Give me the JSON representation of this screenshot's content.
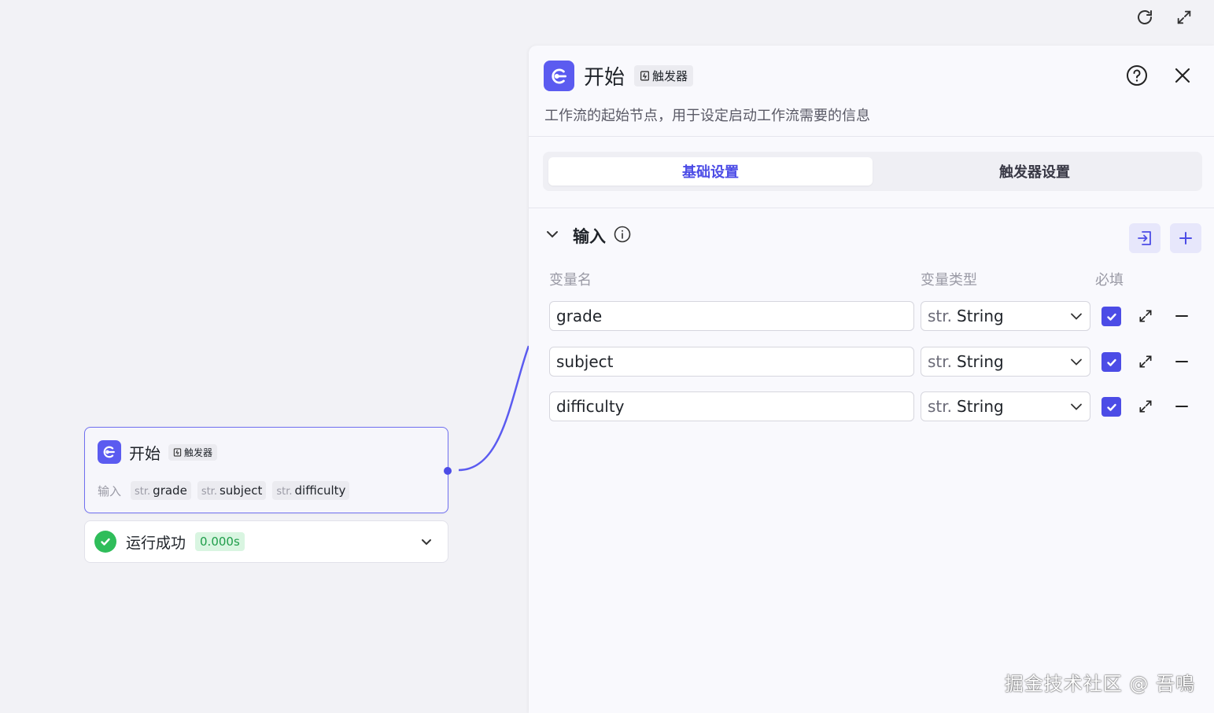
{
  "canvas_node": {
    "title": "开始",
    "trigger_tag": "触发器",
    "inputs_label": "输入",
    "inputs": [
      {
        "type_prefix": "str.",
        "name": "grade"
      },
      {
        "type_prefix": "str.",
        "name": "subject"
      },
      {
        "type_prefix": "str.",
        "name": "difficulty"
      }
    ],
    "accent_color": "#5b5bf0"
  },
  "run_status": {
    "text": "运行成功",
    "duration": "0.000s",
    "status_color": "#2fbd5a"
  },
  "panel": {
    "title": "开始",
    "trigger_tag": "触发器",
    "description": "工作流的起始节点，用于设定启动工作流需要的信息",
    "tabs": [
      {
        "label": "基础设置",
        "active": true
      },
      {
        "label": "触发器设置",
        "active": false
      }
    ],
    "section": {
      "title": "输入",
      "columns": {
        "name": "变量名",
        "type": "变量类型",
        "required": "必填"
      },
      "variables": [
        {
          "name": "grade",
          "type_prefix": "str.",
          "type": "String",
          "required": true
        },
        {
          "name": "subject",
          "type_prefix": "str.",
          "type": "String",
          "required": true
        },
        {
          "name": "difficulty",
          "type_prefix": "str.",
          "type": "String",
          "required": true
        }
      ]
    }
  },
  "watermark": "掘金技术社区 @ 吾鳴"
}
